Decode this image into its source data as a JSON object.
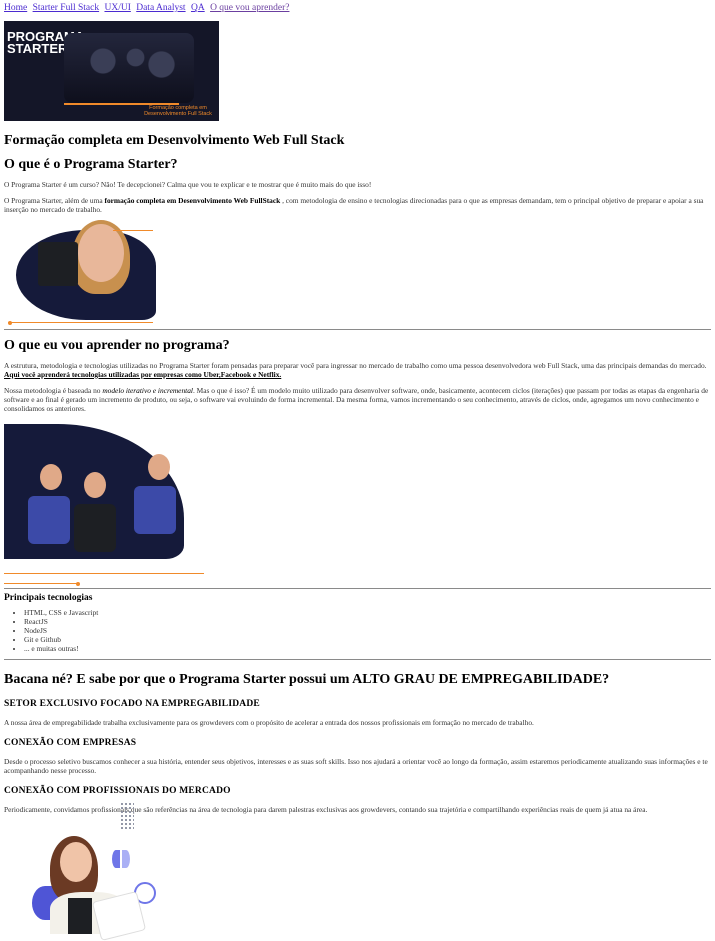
{
  "nav": {
    "links": [
      "Home",
      "Starter Full Stack",
      "UX/UI",
      "Data Analyst",
      "QA",
      "O que vou aprender?"
    ]
  },
  "hero": {
    "brand": "PROGRAMA STARTER",
    "tagline": "Formação completa em Desenvolvimento Full Stack"
  },
  "intro": {
    "subtitle": "Formação completa em Desenvolvimento Web Full Stack",
    "question": "O que é o Programa Starter?",
    "p1": "O Programa Starter é um curso? Não! Te decepcionei? Calma que vou te explicar e te mostrar que é muito mais do que isso!",
    "p2_before": "O Programa Starter, além de uma ",
    "p2_bold": "formação completa em Desenvolvimento Web FullStack",
    "p2_after": " , com metodologia de ensino e tecnologias direcionadas para o que as empresas demandam, tem o principal objetivo de preparar e apoiar a sua inserção no mercado de trabalho."
  },
  "learn": {
    "title": "O que eu vou aprender no programa?",
    "p1_text": "A estrutura, metodologia e tecnologias utilizadas no Programa Starter foram pensadas para preparar você para ingressar no mercado de trabalho como uma pessoa desenvolvedora web Full Stack, uma das principais demandas do mercado. ",
    "p1_link": "Aqui você aprenderá tecnologias utilizadas por empresas como Uber,Facebook e Netflix.",
    "p2_before": "Nossa metodologia é baseada no ",
    "p2_em": "modelo iterativo e incremental",
    "p2_after": ". Mas o que é isso? É um modelo muito utilizado para desenvolver software, onde, basicamente, acontecem ciclos (iterações) que passam por todas as etapas da engenharia de software e ao final é gerado um incremento de produto, ou seja, o software vai evoluindo de forma incremental. Da mesma forma, vamos incrementando o seu conhecimento, através de ciclos, onde, agregamos um novo conhecimento e consolidamos os anteriores."
  },
  "tech": {
    "title": "Principais tecnologias",
    "items": [
      "HTML, CSS e Javascript",
      "ReactJS",
      "NodeJS",
      "Git e Github",
      "... e muitas outras!"
    ]
  },
  "employ": {
    "title": "Bacana né? E sabe por que o Programa Starter possui um ALTO GRAU DE EMPREGABILIDADE?",
    "sections": [
      {
        "heading": "SETOR EXCLUSIVO FOCADO NA EMPREGABILIDADE",
        "text": "A nossa área de empregabilidade trabalha exclusivamente para os growdevers com o propósito de acelerar a entrada dos nossos profissionais em formação no mercado de trabalho."
      },
      {
        "heading": "CONEXÃO COM EMPRESAS",
        "text": "Desde o processo seletivo buscamos conhecer a sua história, entender seus objetivos, interesses e as suas soft skills. Isso nos ajudará a orientar você ao longo da formação, assim estaremos periodicamente atualizando suas informações e te acompanhando nesse processo."
      },
      {
        "heading": "CONEXÃO COM PROFISSIONAIS DO MERCADO",
        "text": "Periodicamente, convidamos profissionais que são referências na área de tecnologia para darem palestras exclusivas aos growdevers, contando sua trajetória e compartilhando experiências reais de quem já atua na área."
      }
    ]
  },
  "colors": {
    "accent": "#f08a2a",
    "navy": "#151a3a",
    "link": "#4b2bd0"
  }
}
